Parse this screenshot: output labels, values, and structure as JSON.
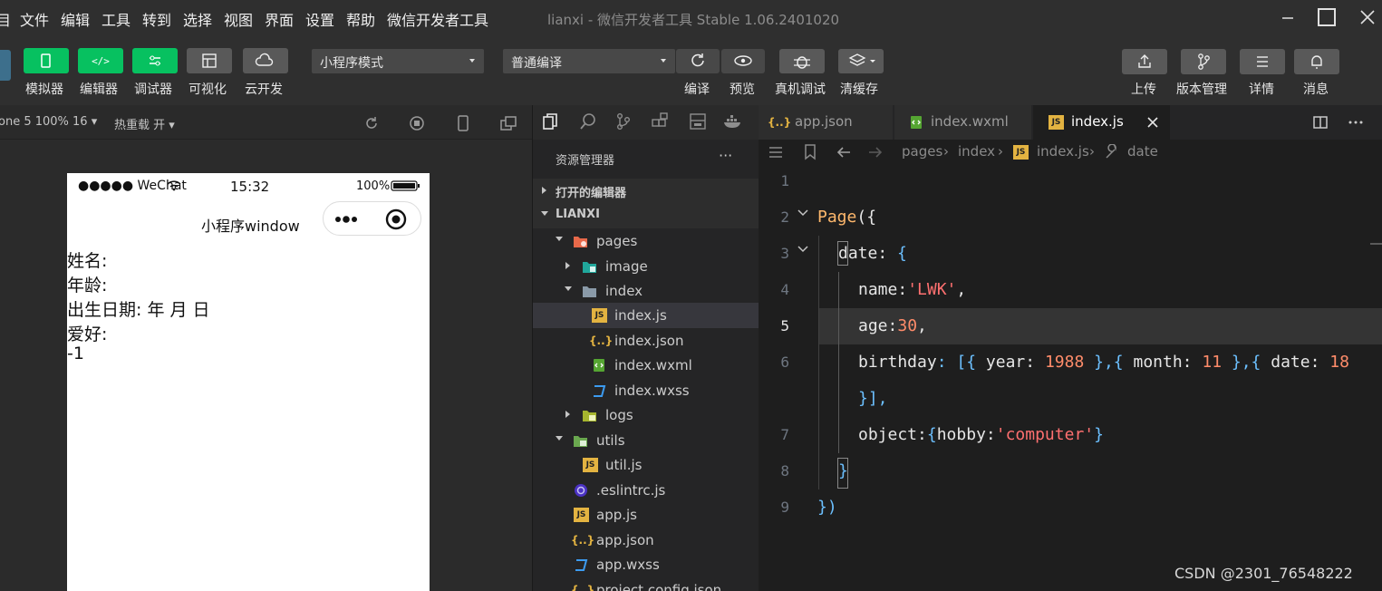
{
  "menubar": {
    "items": [
      "目",
      "文件",
      "编辑",
      "工具",
      "转到",
      "选择",
      "视图",
      "界面",
      "设置",
      "帮助",
      "微信开发者工具"
    ],
    "title": "lianxi - 微信开发者工具 Stable 1.06.2401020"
  },
  "toolbar": {
    "left_buttons": [
      {
        "label": "模拟器",
        "icon": "phone-icon"
      },
      {
        "label": "编辑器",
        "icon": "code-icon"
      },
      {
        "label": "调试器",
        "icon": "debug-toggle-icon"
      },
      {
        "label": "可视化",
        "icon": "layout-icon"
      },
      {
        "label": "云开发",
        "icon": "cloud-icon"
      }
    ],
    "mode_select": "小程序模式",
    "compile_select": "普通编译",
    "mid_buttons": [
      {
        "label": "编译",
        "icon": "refresh-icon"
      },
      {
        "label": "预览",
        "icon": "eye-icon"
      },
      {
        "label": "真机调试",
        "icon": "bug-icon"
      },
      {
        "label": "清缓存",
        "icon": "layers-icon"
      }
    ],
    "right_buttons": [
      {
        "label": "上传",
        "icon": "upload-icon"
      },
      {
        "label": "版本管理",
        "icon": "branch-icon"
      },
      {
        "label": "详情",
        "icon": "menu-icon"
      },
      {
        "label": "消息",
        "icon": "bell-icon"
      }
    ]
  },
  "simulator": {
    "device": "one 5 100% 16 ▾",
    "hot_reload": "热重载 开 ▾",
    "status": {
      "carrier": "●●●●● WeChat",
      "time": "15:32",
      "battery": "100%"
    },
    "nav_title": "小程序window",
    "lines": [
      "姓名:",
      "年龄:",
      "出生日期: 年 月 日",
      "爱好:",
      "-1"
    ]
  },
  "explorer": {
    "title": "资源管理器",
    "more": "···",
    "open_editors": "打开的编辑器",
    "project": "LIANXI",
    "items": [
      {
        "label": "pages",
        "type": "folder"
      },
      {
        "label": "image",
        "type": "folder"
      },
      {
        "label": "index",
        "type": "folder"
      },
      {
        "label": "index.js",
        "type": "js"
      },
      {
        "label": "index.json",
        "type": "json"
      },
      {
        "label": "index.wxml",
        "type": "wxml"
      },
      {
        "label": "index.wxss",
        "type": "wxss"
      },
      {
        "label": "logs",
        "type": "folder"
      },
      {
        "label": "utils",
        "type": "folder"
      },
      {
        "label": "util.js",
        "type": "js"
      },
      {
        "label": ".eslintrc.js",
        "type": "eslint"
      },
      {
        "label": "app.js",
        "type": "js"
      },
      {
        "label": "app.json",
        "type": "json"
      },
      {
        "label": "app.wxss",
        "type": "wxss"
      },
      {
        "label": "project.config.json",
        "type": "json"
      }
    ]
  },
  "editor": {
    "tabs": [
      {
        "label": "app.json",
        "icon": "json-icon"
      },
      {
        "label": "index.wxml",
        "icon": "wxml-icon"
      },
      {
        "label": "index.js",
        "icon": "js-icon"
      }
    ],
    "breadcrumb": [
      "pages",
      "index",
      "index.js",
      "date"
    ],
    "line_numbers": [
      "1",
      "2",
      "3",
      "4",
      "5",
      "6",
      "",
      "7",
      "8",
      "9"
    ],
    "code": {
      "l2a": "Page",
      "l2b": "({",
      "l3a": "date",
      "l3b": ":",
      "l3c": "{",
      "l4a": "name",
      "l4b": ":",
      "l4c": "'LWK'",
      "l4d": ",",
      "l5a": "age",
      "l5b": ":",
      "l5c": "30",
      "l5d": ",",
      "l6a": "birthday",
      "l6b": ": [{ ",
      "l6c": "year",
      "l6d": ": ",
      "l6e": "1988",
      "l6f": " },{ ",
      "l6g": "month",
      "l6h": ": ",
      "l6i": "11",
      "l6j": " },{ ",
      "l6k": "date",
      "l6l": ": ",
      "l6m": "18",
      "l6n": "}],",
      "l7a": "object",
      "l7b": ":",
      "l7c": "{",
      "l7d": "hobby",
      "l7e": ":",
      "l7f": "'computer'",
      "l7g": "}",
      "l8": "}",
      "l9": "})"
    }
  },
  "watermark": "CSDN @2301_76548222"
}
